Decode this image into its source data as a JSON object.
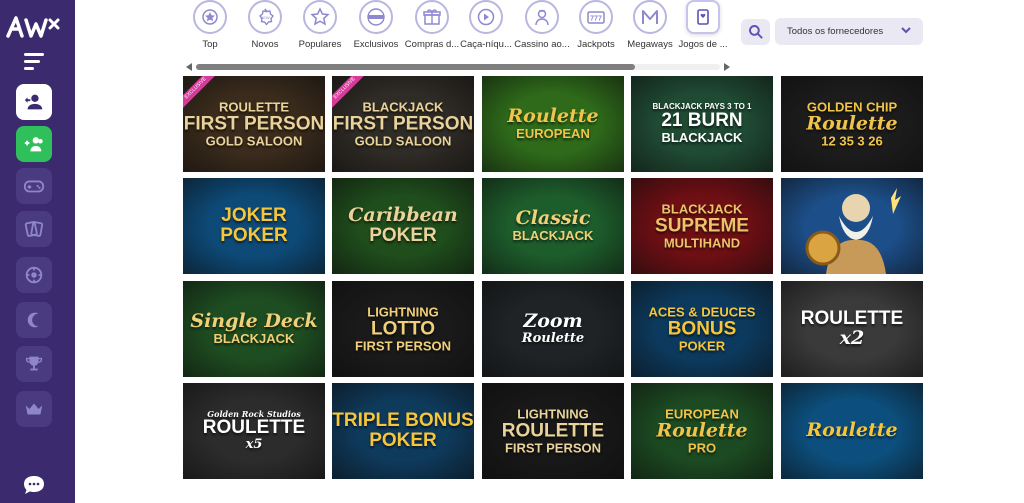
{
  "logo": {
    "text": "AW"
  },
  "sidebar": {
    "icons": [
      "user-switch-icon",
      "users-add-icon",
      "gamepad-icon",
      "cards-icon",
      "chip-icon",
      "crescent-icon",
      "trophy-icon",
      "crown-icon",
      "chat-icon"
    ]
  },
  "categories": [
    {
      "label": "Top",
      "icon": "star-badge-icon"
    },
    {
      "label": "Novos",
      "icon": "new-badge-icon"
    },
    {
      "label": "Populares",
      "icon": "star-icon"
    },
    {
      "label": "Exclusivos",
      "icon": "exclusive-badge-icon"
    },
    {
      "label": "Compras d...",
      "icon": "gift-icon"
    },
    {
      "label": "Caça-níqu...",
      "icon": "play-icon"
    },
    {
      "label": "Cassino ao...",
      "icon": "dealer-icon"
    },
    {
      "label": "Jackpots",
      "icon": "slot-icon"
    },
    {
      "label": "Megaways",
      "icon": "m-icon"
    },
    {
      "label": "Jogos de ...",
      "icon": "card-icon"
    }
  ],
  "provider_select": {
    "value": "Todos os fornecedores"
  },
  "colors": {
    "sidebar": "#3b2a6e",
    "accent_green": "#2fbf5b",
    "icon_purple": "#6b64c4"
  },
  "games": [
    {
      "title_lines": [
        "ROULETTE",
        "FIRST PERSON",
        "GOLD SALOON"
      ],
      "badge": "EXCLUSIVE",
      "bg": "#3a2b1c",
      "fg": "#e9d39b"
    },
    {
      "title_lines": [
        "BLACKJACK",
        "FIRST PERSON",
        "GOLD SALOON"
      ],
      "badge": "EXCLUSIVE",
      "bg": "#2f2b26",
      "fg": "#e9d39b"
    },
    {
      "title_lines": [
        "Roulette",
        "EUROPEAN"
      ],
      "bg": "#2e6a1a",
      "fg": "#f0c44a"
    },
    {
      "title_lines": [
        "BLACKJACK PAYS 3 TO 1",
        "21 BURN",
        "BLACKJACK"
      ],
      "bg": "#1f4a33",
      "fg": "#ffffff"
    },
    {
      "title_lines": [
        "GOLDEN CHIP",
        "Roulette",
        "12 35 3 26"
      ],
      "bg": "#1c1c1c",
      "fg": "#f0c44a"
    },
    {
      "title_lines": [
        "JOKER",
        "POKER"
      ],
      "bg": "#0d4a78",
      "fg": "#f6c53a"
    },
    {
      "title_lines": [
        "Caribbean",
        "POKER"
      ],
      "bg": "#1f4d1c",
      "fg": "#e9d39b"
    },
    {
      "title_lines": [
        "Classic",
        "BLACKJACK"
      ],
      "bg": "#1d5c2b",
      "fg": "#f0d078"
    },
    {
      "title_lines": [
        "BLACKJACK",
        "SUPREME",
        "MULTIHAND"
      ],
      "bg": "#6e0f14",
      "fg": "#e9c46a"
    },
    {
      "title_lines": [],
      "bg": "#1c4f8a",
      "fg": "#ffffff"
    },
    {
      "title_lines": [
        "Single Deck",
        "BLACKJACK"
      ],
      "bg": "#1e4d21",
      "fg": "#f0d078"
    },
    {
      "title_lines": [
        "LIGHTNING",
        "LOTTO",
        "FIRST PERSON"
      ],
      "bg": "#1a1a1a",
      "fg": "#f0d078"
    },
    {
      "title_lines": [
        "Zoom",
        "Roulette"
      ],
      "bg": "#1f2326",
      "fg": "#ffffff"
    },
    {
      "title_lines": [
        "ACES & DEUCES",
        "BONUS",
        "POKER"
      ],
      "bg": "#0c3a5e",
      "fg": "#f6c53a"
    },
    {
      "title_lines": [
        "ROULETTE",
        "x2"
      ],
      "bg": "#3a3a3a",
      "fg": "#ffffff"
    },
    {
      "title_lines": [
        "Golden Rock Studios",
        "ROULETTE",
        "x5"
      ],
      "bg": "#2c2c2c",
      "fg": "#ffffff"
    },
    {
      "title_lines": [
        "TRIPLE BONUS",
        "POKER"
      ],
      "bg": "#0e3a5c",
      "fg": "#f6c53a"
    },
    {
      "title_lines": [
        "LIGHTNING",
        "ROULETTE",
        "FIRST PERSON"
      ],
      "bg": "#181818",
      "fg": "#e9d39b"
    },
    {
      "title_lines": [
        "EUROPEAN",
        "Roulette",
        "PRO"
      ],
      "bg": "#1c4a22",
      "fg": "#f0c44a"
    },
    {
      "title_lines": [
        "Roulette"
      ],
      "bg": "#0c4f7e",
      "fg": "#f6c53a"
    }
  ]
}
